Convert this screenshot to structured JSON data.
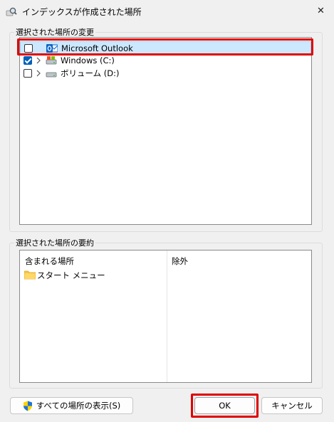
{
  "window": {
    "title": "インデックスが作成された場所",
    "close_glyph": "✕",
    "icon": "search-magnifier-icon"
  },
  "change_group": {
    "legend": "選択された場所の変更",
    "items": [
      {
        "label": "Microsoft Outlook",
        "checked": false,
        "expandable": false,
        "icon": "outlook-icon",
        "selected": true
      },
      {
        "label": "Windows (C:)",
        "checked": true,
        "expandable": true,
        "icon": "drive-icon",
        "selected": false
      },
      {
        "label": "ボリューム (D:)",
        "checked": false,
        "expandable": true,
        "icon": "drive-icon",
        "selected": false
      }
    ]
  },
  "summary_group": {
    "legend": "選択された場所の要約",
    "included_header": "含まれる場所",
    "excluded_header": "除外",
    "included_items": [
      {
        "label": "スタート メニュー",
        "icon": "folder-icon"
      }
    ]
  },
  "buttons": {
    "show_all": "すべての場所の表示(S)",
    "ok": "OK",
    "cancel": "キャンセル"
  },
  "colors": {
    "highlight_border": "#e00000",
    "selection_bg": "#cce8ff",
    "checkbox_checked": "#005fb8"
  }
}
